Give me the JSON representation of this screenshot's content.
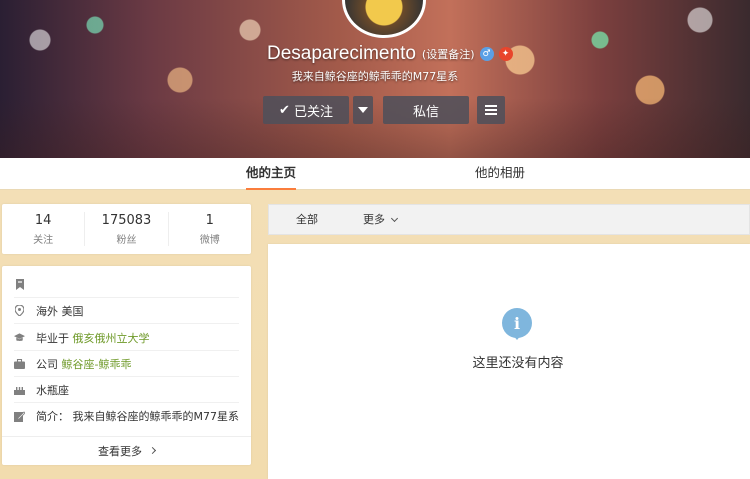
{
  "profile": {
    "name": "Desaparecimento",
    "remark": "(设置备注)",
    "gender_badge": "male-icon",
    "vip_badge": "vip-icon",
    "bio": "我来自鲸谷座的鲸乖乖的M77星系"
  },
  "actions": {
    "follow_label": "已关注",
    "message_label": "私信"
  },
  "tabs": [
    {
      "label": "他的主页",
      "active": true
    },
    {
      "label": "他的相册",
      "active": false
    }
  ],
  "stats": [
    {
      "value": "14",
      "label": "关注"
    },
    {
      "value": "175083",
      "label": "粉丝"
    },
    {
      "value": "1",
      "label": "微博"
    }
  ],
  "info": {
    "location": "海外 美国",
    "school_prefix": "毕业于",
    "school": "俄亥俄州立大学",
    "company_prefix": "公司",
    "company": "鲸谷座-鲸乖乖",
    "zodiac": "水瓶座",
    "intro_prefix": "简介：",
    "intro": "我来自鲸谷座的鲸乖乖的M77星系",
    "more_label": "查看更多"
  },
  "filter": {
    "all_label": "全部",
    "more_label": "更多"
  },
  "empty": {
    "message": "这里还没有内容"
  },
  "colors": {
    "accent": "#fa7d3c",
    "link": "#6f9a29",
    "info_icon": "#7fb6dd"
  }
}
